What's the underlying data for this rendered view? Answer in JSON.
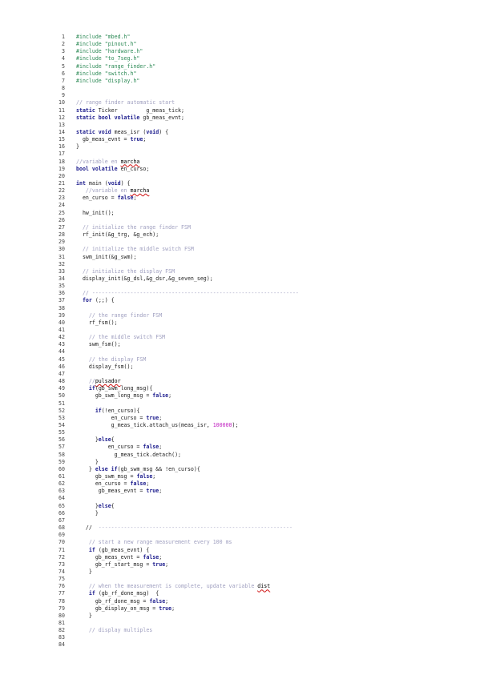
{
  "colors": {
    "keyword": "#1a1a8c",
    "comment": "#a0a0c0",
    "preprocessor": "#2e8b57",
    "literal": "#c020c0",
    "plain": "#222222",
    "spellcheck": "#d01010"
  },
  "lines": [
    {
      "n": "1",
      "t": [
        {
          "c": "pp",
          "s": "#include \"mbed.h\""
        }
      ]
    },
    {
      "n": "2",
      "t": [
        {
          "c": "pp",
          "s": "#include \"pinout.h\""
        }
      ]
    },
    {
      "n": "3",
      "t": [
        {
          "c": "pp",
          "s": "#include \"hardware.h\""
        }
      ]
    },
    {
      "n": "4",
      "t": [
        {
          "c": "pp",
          "s": "#include \"to_7seg.h\""
        }
      ]
    },
    {
      "n": "5",
      "t": [
        {
          "c": "pp",
          "s": "#include \"range_finder.h\""
        }
      ]
    },
    {
      "n": "6",
      "t": [
        {
          "c": "pp",
          "s": "#include \"switch.h\""
        }
      ]
    },
    {
      "n": "7",
      "t": [
        {
          "c": "pp",
          "s": "#include \"display.h\""
        }
      ]
    },
    {
      "n": "8",
      "t": []
    },
    {
      "n": "9",
      "t": []
    },
    {
      "n": "10",
      "t": [
        {
          "c": "cm",
          "s": "// range finder automatic start"
        }
      ]
    },
    {
      "n": "11",
      "t": [
        {
          "c": "kw",
          "s": "static"
        },
        {
          "c": "n",
          "s": " Ticker         g_meas_tick;"
        }
      ]
    },
    {
      "n": "12",
      "t": [
        {
          "c": "kw",
          "s": "static bool volatile"
        },
        {
          "c": "n",
          "s": " gb_meas_evnt;"
        }
      ]
    },
    {
      "n": "13",
      "t": []
    },
    {
      "n": "14",
      "t": [
        {
          "c": "kw",
          "s": "static void"
        },
        {
          "c": "n",
          "s": " meas_isr ("
        },
        {
          "c": "kw",
          "s": "void"
        },
        {
          "c": "n",
          "s": ") {"
        }
      ]
    },
    {
      "n": "15",
      "t": [
        {
          "c": "n",
          "s": "  gb_meas_evnt = "
        },
        {
          "c": "kw",
          "s": "true"
        },
        {
          "c": "n",
          "s": ";"
        }
      ]
    },
    {
      "n": "16",
      "t": [
        {
          "c": "n",
          "s": "}"
        }
      ]
    },
    {
      "n": "17",
      "t": []
    },
    {
      "n": "18",
      "t": [
        {
          "c": "cm",
          "s": "//variable en "
        },
        {
          "c": "sq",
          "s": "marcha"
        }
      ]
    },
    {
      "n": "19",
      "t": [
        {
          "c": "kw",
          "s": "bool volatile"
        },
        {
          "c": "n",
          "s": " en_curso;"
        }
      ]
    },
    {
      "n": "20",
      "t": []
    },
    {
      "n": "21",
      "t": [
        {
          "c": "kw",
          "s": "int"
        },
        {
          "c": "n",
          "s": " main ("
        },
        {
          "c": "kw",
          "s": "void"
        },
        {
          "c": "n",
          "s": ") {"
        }
      ]
    },
    {
      "n": "22",
      "t": [
        {
          "c": "cm",
          "s": "   //variable en "
        },
        {
          "c": "sq",
          "s": "marcha"
        }
      ]
    },
    {
      "n": "23",
      "t": [
        {
          "c": "n",
          "s": "  en_curso = "
        },
        {
          "c": "kw",
          "s": "false"
        },
        {
          "c": "n",
          "s": ";"
        }
      ]
    },
    {
      "n": "24",
      "t": []
    },
    {
      "n": "25",
      "t": [
        {
          "c": "n",
          "s": "  hw_init();"
        }
      ]
    },
    {
      "n": "26",
      "t": []
    },
    {
      "n": "27",
      "t": [
        {
          "c": "cm",
          "s": "  // initialize the range finder FSM"
        }
      ]
    },
    {
      "n": "28",
      "t": [
        {
          "c": "n",
          "s": "  rf_init(&g_trg, &g_ech);"
        }
      ]
    },
    {
      "n": "29",
      "t": []
    },
    {
      "n": "30",
      "t": [
        {
          "c": "cm",
          "s": "  // initialize the middle switch FSM"
        }
      ]
    },
    {
      "n": "31",
      "t": [
        {
          "c": "n",
          "s": "  swm_init(&g_swm);"
        }
      ]
    },
    {
      "n": "32",
      "t": []
    },
    {
      "n": "33",
      "t": [
        {
          "c": "cm",
          "s": "  // initialize the display FSM"
        }
      ]
    },
    {
      "n": "34",
      "t": [
        {
          "c": "n",
          "s": "  display_init(&g_dsl,&g_dsr,&g_seven_seg);"
        }
      ]
    },
    {
      "n": "35",
      "t": []
    },
    {
      "n": "36",
      "t": [
        {
          "c": "cm",
          "s": "  // -----------------------------------------------------------------"
        }
      ]
    },
    {
      "n": "37",
      "t": [
        {
          "c": "n",
          "s": "  "
        },
        {
          "c": "kw",
          "s": "for"
        },
        {
          "c": "n",
          "s": " (;;) {"
        }
      ]
    },
    {
      "n": "38",
      "t": []
    },
    {
      "n": "39",
      "t": [
        {
          "c": "cm",
          "s": "    // the range finder FSM"
        }
      ]
    },
    {
      "n": "40",
      "t": [
        {
          "c": "n",
          "s": "    rf_fsm();"
        }
      ]
    },
    {
      "n": "41",
      "t": []
    },
    {
      "n": "42",
      "t": [
        {
          "c": "cm",
          "s": "    // the middle switch FSM"
        }
      ]
    },
    {
      "n": "43",
      "t": [
        {
          "c": "n",
          "s": "    swm_fsm();"
        }
      ]
    },
    {
      "n": "44",
      "t": []
    },
    {
      "n": "45",
      "t": [
        {
          "c": "cm",
          "s": "    // the display FSM"
        }
      ]
    },
    {
      "n": "46",
      "t": [
        {
          "c": "n",
          "s": "    display_fsm();"
        }
      ]
    },
    {
      "n": "47",
      "t": []
    },
    {
      "n": "48",
      "t": [
        {
          "c": "cm",
          "s": "    //"
        },
        {
          "c": "sq",
          "s": "pulsador"
        }
      ]
    },
    {
      "n": "49",
      "t": [
        {
          "c": "n",
          "s": "    "
        },
        {
          "c": "kw",
          "s": "if"
        },
        {
          "c": "n",
          "s": "(gb_swm_long_msg){"
        }
      ]
    },
    {
      "n": "50",
      "t": [
        {
          "c": "n",
          "s": "      gb_swm_long_msg = "
        },
        {
          "c": "kw",
          "s": "false"
        },
        {
          "c": "n",
          "s": ";"
        }
      ]
    },
    {
      "n": "51",
      "t": []
    },
    {
      "n": "52",
      "t": [
        {
          "c": "n",
          "s": "      "
        },
        {
          "c": "kw",
          "s": "if"
        },
        {
          "c": "n",
          "s": "(!en_curso){"
        }
      ]
    },
    {
      "n": "53",
      "t": [
        {
          "c": "n",
          "s": "           en_curso = "
        },
        {
          "c": "kw",
          "s": "true"
        },
        {
          "c": "n",
          "s": ";"
        }
      ]
    },
    {
      "n": "54",
      "t": [
        {
          "c": "n",
          "s": "           g_meas_tick.attach_us(meas_isr, "
        },
        {
          "c": "lt",
          "s": "100000"
        },
        {
          "c": "n",
          "s": ");"
        }
      ]
    },
    {
      "n": "55",
      "t": []
    },
    {
      "n": "56",
      "t": [
        {
          "c": "n",
          "s": "      }"
        },
        {
          "c": "kw",
          "s": "else"
        },
        {
          "c": "n",
          "s": "{"
        }
      ]
    },
    {
      "n": "57",
      "t": [
        {
          "c": "n",
          "s": "          en_curso = "
        },
        {
          "c": "kw",
          "s": "false"
        },
        {
          "c": "n",
          "s": ";"
        }
      ]
    },
    {
      "n": "58",
      "t": [
        {
          "c": "n",
          "s": "            g_meas_tick.detach();"
        }
      ]
    },
    {
      "n": "59",
      "t": [
        {
          "c": "n",
          "s": "      }"
        }
      ]
    },
    {
      "n": "60",
      "t": [
        {
          "c": "n",
          "s": "    } "
        },
        {
          "c": "kw",
          "s": "else if"
        },
        {
          "c": "n",
          "s": "(gb_swm_msg && !en_curso){"
        }
      ]
    },
    {
      "n": "61",
      "t": [
        {
          "c": "n",
          "s": "      gb_swm_msg = "
        },
        {
          "c": "kw",
          "s": "false"
        },
        {
          "c": "n",
          "s": ";"
        }
      ]
    },
    {
      "n": "62",
      "t": [
        {
          "c": "n",
          "s": "      en_curso = "
        },
        {
          "c": "kw",
          "s": "false"
        },
        {
          "c": "n",
          "s": ";"
        }
      ]
    },
    {
      "n": "63",
      "t": [
        {
          "c": "n",
          "s": "       gb_meas_evnt = "
        },
        {
          "c": "kw",
          "s": "true"
        },
        {
          "c": "n",
          "s": ";"
        }
      ]
    },
    {
      "n": "64",
      "t": []
    },
    {
      "n": "65",
      "t": [
        {
          "c": "n",
          "s": "      }"
        },
        {
          "c": "kw",
          "s": "else"
        },
        {
          "c": "n",
          "s": "{"
        }
      ]
    },
    {
      "n": "66",
      "t": [
        {
          "c": "n",
          "s": "      }"
        }
      ]
    },
    {
      "n": "67",
      "t": []
    },
    {
      "n": "68",
      "t": [
        {
          "c": "n",
          "s": "   //  "
        },
        {
          "c": "cm",
          "s": "-------------------------------------------------------------"
        }
      ]
    },
    {
      "n": "69",
      "t": []
    },
    {
      "n": "70",
      "t": [
        {
          "c": "cm",
          "s": "    // start a new range measurement every 100 ms"
        }
      ]
    },
    {
      "n": "71",
      "t": [
        {
          "c": "n",
          "s": "    "
        },
        {
          "c": "kw",
          "s": "if"
        },
        {
          "c": "n",
          "s": " (gb_meas_evnt) {"
        }
      ]
    },
    {
      "n": "72",
      "t": [
        {
          "c": "n",
          "s": "      gb_meas_evnt = "
        },
        {
          "c": "kw",
          "s": "false"
        },
        {
          "c": "n",
          "s": ";"
        }
      ]
    },
    {
      "n": "73",
      "t": [
        {
          "c": "n",
          "s": "      gb_rf_start_msg = "
        },
        {
          "c": "kw",
          "s": "true"
        },
        {
          "c": "n",
          "s": ";"
        }
      ]
    },
    {
      "n": "74",
      "t": [
        {
          "c": "n",
          "s": "    }"
        }
      ]
    },
    {
      "n": "75",
      "t": []
    },
    {
      "n": "76",
      "t": [
        {
          "c": "cm",
          "s": "    // when the measurement is complete, update variable "
        },
        {
          "c": "sq",
          "s": "dist"
        }
      ]
    },
    {
      "n": "77",
      "t": [
        {
          "c": "n",
          "s": "    "
        },
        {
          "c": "kw",
          "s": "if"
        },
        {
          "c": "n",
          "s": " (gb_rf_done_msg)  {"
        }
      ]
    },
    {
      "n": "78",
      "t": [
        {
          "c": "n",
          "s": "      gb_rf_done_msg = "
        },
        {
          "c": "kw",
          "s": "false"
        },
        {
          "c": "n",
          "s": ";"
        }
      ]
    },
    {
      "n": "79",
      "t": [
        {
          "c": "n",
          "s": "      gb_display_on_msg = "
        },
        {
          "c": "kw",
          "s": "true"
        },
        {
          "c": "n",
          "s": ";"
        }
      ]
    },
    {
      "n": "80",
      "t": [
        {
          "c": "n",
          "s": "    }"
        }
      ]
    },
    {
      "n": "81",
      "t": []
    },
    {
      "n": "82",
      "t": [
        {
          "c": "cm",
          "s": "    // display multiples"
        }
      ]
    },
    {
      "n": "83",
      "t": []
    },
    {
      "n": "84",
      "t": []
    }
  ]
}
